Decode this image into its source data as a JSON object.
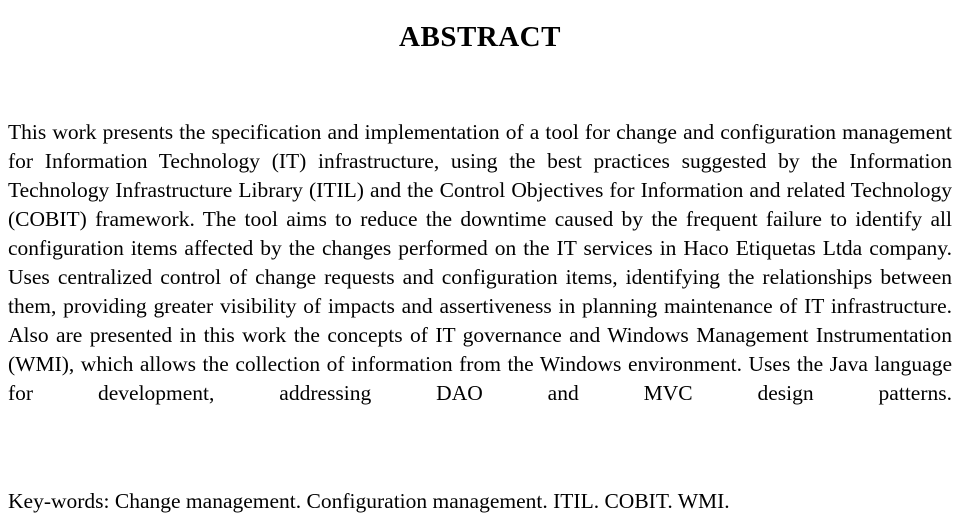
{
  "document": {
    "title": "ABSTRACT",
    "background_color": "#ffffff",
    "text_color": "#000000",
    "abstract_paragraph": "This work presents the specification and implementation of a tool for change and configuration management for Information Technology (IT) infrastructure, using the best practices suggested by the Information Technology Infrastructure Library (ITIL) and the Control Objectives for Information and related Technology (COBIT) framework. The tool aims to reduce the downtime caused by the frequent failure to identify all configuration items affected by the changes performed on the IT services in Haco Etiquetas Ltda company. Uses centralized control of change requests and configuration items, identifying the relationships between them, providing greater visibility of impacts and assertiveness in planning maintenance of IT infrastructure. Also are presented in this work the concepts of IT governance and Windows Management Instrumentation (WMI), which allows the collection of information from the Windows environment. Uses the Java language for development, addressing DAO and MVC design patterns.",
    "keywords_line": "Key-words: Change management. Configuration management. ITIL. COBIT. WMI.",
    "keywords_label": "Key-words:",
    "keywords": [
      "Change management.",
      "Configuration management.",
      "ITIL.",
      "COBIT.",
      "WMI."
    ]
  }
}
